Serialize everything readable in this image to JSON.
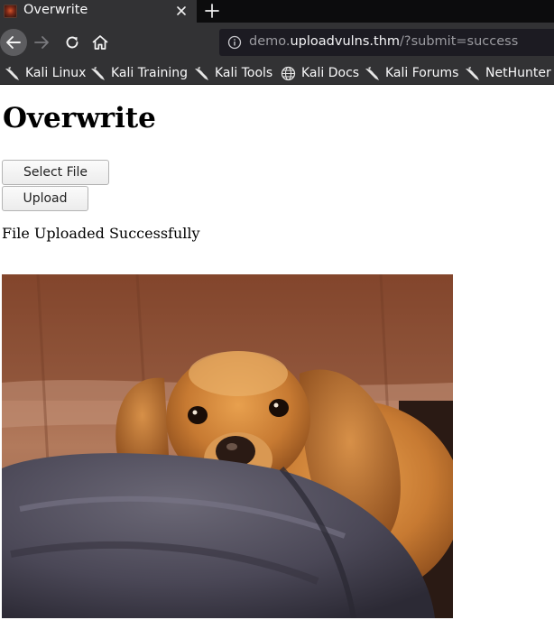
{
  "browser": {
    "tab": {
      "title": "Overwrite",
      "favicon": "site-favicon"
    },
    "nav": {
      "back_icon": "back-arrow-icon",
      "forward_icon": "forward-arrow-icon",
      "reload_icon": "reload-icon",
      "home_icon": "home-icon"
    },
    "url": {
      "prefix": "demo.",
      "host": "uploadvulns.thm",
      "path": "/?submit=success"
    },
    "bookmarks": [
      {
        "label": "Kali Linux",
        "icon": "kali-dragon-icon"
      },
      {
        "label": "Kali Training",
        "icon": "kali-dragon-icon"
      },
      {
        "label": "Kali Tools",
        "icon": "kali-dragon-icon"
      },
      {
        "label": "Kali Docs",
        "icon": "globe-icon"
      },
      {
        "label": "Kali Forums",
        "icon": "kali-dragon-icon"
      },
      {
        "label": "NetHunter",
        "icon": "kali-dragon-icon"
      }
    ]
  },
  "page": {
    "title": "Overwrite",
    "select_file_label": "Select File",
    "upload_label": "Upload",
    "status_text": "File Uploaded Successfully",
    "image": "uploaded photo of a cocker spaniel resting its head on a cushion"
  },
  "colors": {
    "tabbar": "#0c0c0d",
    "toolbar": "#323234",
    "urlbar": "#1c1b22",
    "url_dim": "#9b9ba0",
    "url_host": "#f4f4f6"
  }
}
